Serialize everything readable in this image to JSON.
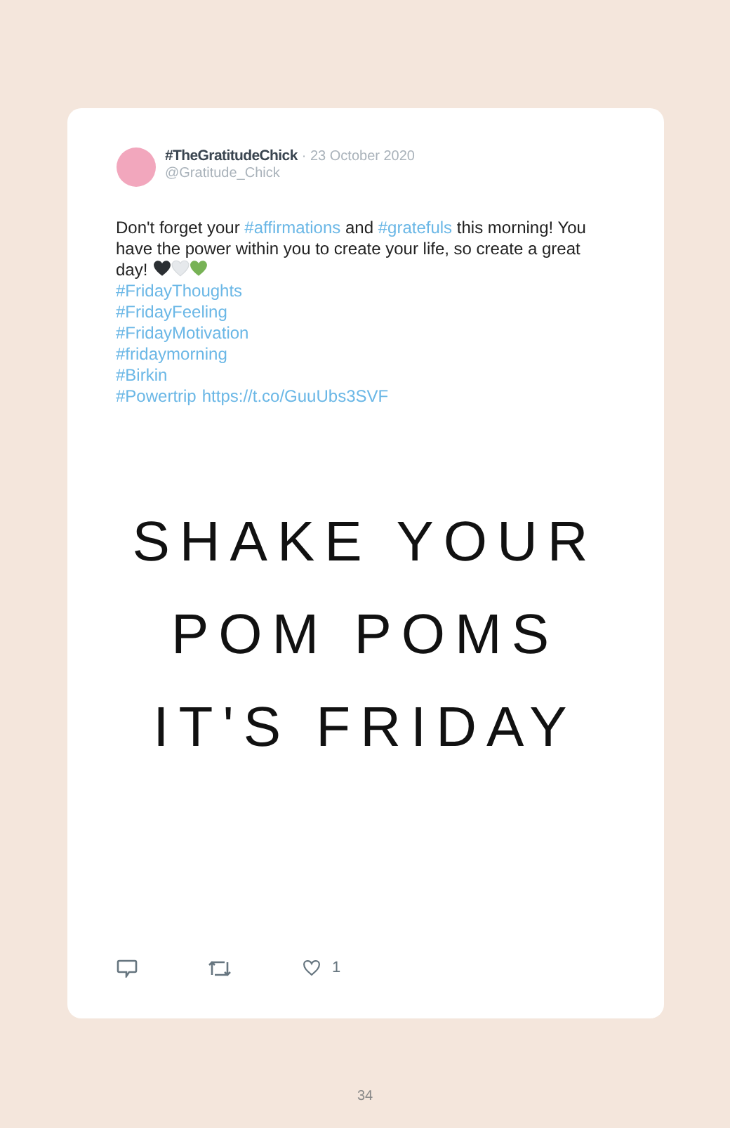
{
  "tweet": {
    "name": "#TheGratitudeChick",
    "date": "· 23 October 2020",
    "handle": "@Gratitude_Chick",
    "body": [
      {
        "kind": "plain",
        "text": "Don't forget your "
      },
      {
        "kind": "hashtag",
        "text": "#affirmations"
      },
      {
        "kind": "plain",
        "text": " and "
      },
      {
        "kind": "hashtag",
        "text": "#gratefuls"
      },
      {
        "kind": "plain",
        "text": " this morning! You have the power within you to create your life, so create a great day!"
      }
    ],
    "emoji": [
      {
        "color": "#2b2f33"
      },
      {
        "color": "#e6e9ec"
      },
      {
        "color": "#77b255"
      }
    ],
    "tag_lines": [
      [
        "#FridayThoughts"
      ],
      [
        "#FridayFeeling"
      ],
      [
        "#FridayMotivation"
      ],
      [
        "#fridaymorning"
      ],
      [
        "#Birkin"
      ],
      [
        "#Powertrip",
        "https://t.co/GuuUbs3SVF"
      ]
    ],
    "media_lines": [
      "SHAKE YOUR",
      "POM POMS",
      "IT'S FRIDAY"
    ],
    "likes": "1"
  },
  "page_number": "34"
}
